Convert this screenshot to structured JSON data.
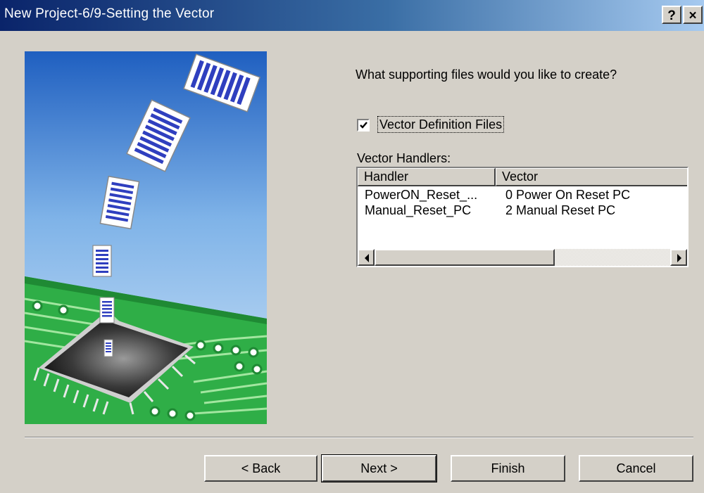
{
  "window": {
    "title": "New Project-6/9-Setting the Vector",
    "help_button": "?",
    "close_button": "×"
  },
  "main": {
    "question": "What supporting files would you like to create?",
    "vector_definition": {
      "label": "Vector Definition Files",
      "checked": true
    },
    "handlers_label": "Vector Handlers:",
    "list": {
      "columns": [
        "Handler",
        "Vector"
      ],
      "rows": [
        {
          "handler": "PowerON_Reset_...",
          "vector": "0 Power On Reset PC"
        },
        {
          "handler": "Manual_Reset_PC",
          "vector": "2 Manual Reset PC"
        }
      ]
    }
  },
  "buttons": {
    "back": "< Back",
    "next": "Next >",
    "finish": "Finish",
    "cancel": "Cancel"
  },
  "colors": {
    "titlebar_start": "#0a246a",
    "titlebar_end": "#a6caf0",
    "face": "#d4d0c8",
    "pcb_green": "#33b54a",
    "document_stripes": "#2f3fbf"
  }
}
